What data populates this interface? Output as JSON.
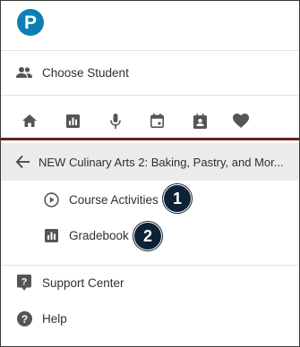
{
  "logo": {
    "letter": "P",
    "brand_color": "#0b7fb3"
  },
  "choose_student": {
    "label": "Choose Student",
    "icon": "people-icon"
  },
  "nav_icons": [
    {
      "name": "home-icon"
    },
    {
      "name": "bar-chart-icon"
    },
    {
      "name": "microphone-icon"
    },
    {
      "name": "calendar-icon"
    },
    {
      "name": "contact-card-icon"
    },
    {
      "name": "heart-icon"
    }
  ],
  "course": {
    "back_icon": "arrow-left-icon",
    "title": "NEW Culinary Arts 2: Baking, Pastry, and Mor..."
  },
  "course_menu": [
    {
      "label": "Course Activities",
      "icon": "play-circle-icon",
      "badge": "1"
    },
    {
      "label": "Gradebook",
      "icon": "gradebook-icon",
      "badge": "2"
    }
  ],
  "footer": {
    "support_label": "Support Center",
    "help_label": "Help"
  },
  "colors": {
    "accent_bar": "#6b1f1f",
    "badge_bg": "#0e2236",
    "icon_gray": "#555555"
  }
}
